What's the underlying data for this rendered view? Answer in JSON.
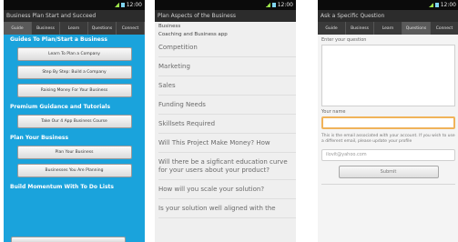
{
  "status": {
    "time": "12:00"
  },
  "phone1": {
    "title": "Business Plan Start and Succeed",
    "tabs": [
      "Guide",
      "Business",
      "Learn",
      "Questions",
      "Connect"
    ],
    "sections": [
      {
        "heading": "Guides To Plan/Start a Business",
        "buttons": [
          "Learn To Plan a Company",
          "Step By Step: Build a Company",
          "Raising Money For Your Business"
        ]
      },
      {
        "heading": "Premium Guidance and Tutorials",
        "buttons": [
          "Take Our 4 App Business Course"
        ]
      },
      {
        "heading": "Plan Your Business",
        "buttons": [
          "Plan Your Business",
          "Businesses You Are Planning"
        ]
      },
      {
        "heading": "Build Momentum With To Do Lists",
        "buttons": []
      }
    ]
  },
  "phone2": {
    "title": "Plan Aspects of the Business",
    "header_lines": [
      "Business",
      "Coaching and Business app"
    ],
    "items": [
      "Competition",
      "Marketing",
      "Sales",
      "Funding Needs",
      "Skillsets Required",
      "Will This Project Make Money? How",
      "Will there be a sigficant education curve for your users about your product?",
      "How will you scale your solution?",
      "Is your solution well aligned with the"
    ]
  },
  "phone3": {
    "title": "Ask a Specific Question",
    "tabs": [
      "Guide",
      "Business",
      "Learn",
      "Questions",
      "Connect"
    ],
    "question_label": "Enter your question",
    "name_label": "Your name",
    "note": "This is the email associated with your account. If you wish to use a different email, please update your profile",
    "email_value": "ilovit@yahoo.com",
    "submit_label": "Submit"
  }
}
